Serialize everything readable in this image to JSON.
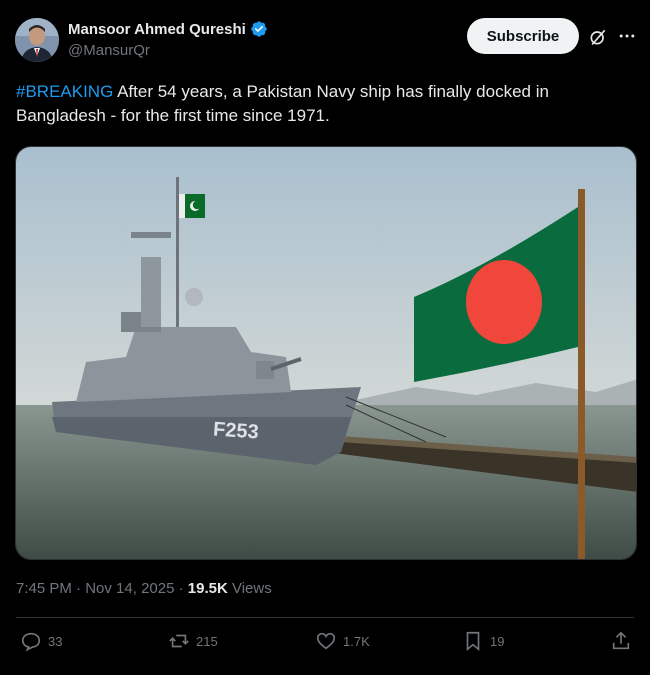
{
  "author": {
    "name": "Mansoor Ahmed Qureshi",
    "handle": "@MansurQr",
    "verified_icon": "verified-badge-icon",
    "verified_color": "#1d9bf0"
  },
  "header": {
    "subscribe_label": "Subscribe"
  },
  "post": {
    "hashtag": "#BREAKING",
    "text": " After 54 years, a Pakistan Navy ship has finally docked in Bangladesh - for the first time since 1971.",
    "ship_marking": "F253"
  },
  "meta": {
    "time": "7:45 PM",
    "separator": " · ",
    "date": "Nov 14, 2025",
    "views_count": "19.5K",
    "views_label": " Views"
  },
  "actions": {
    "replies": "33",
    "reposts": "215",
    "likes": "1.7K",
    "bookmarks": "19"
  },
  "colors": {
    "background": "#000000",
    "accent": "#1d9bf0",
    "muted": "#71767b"
  }
}
